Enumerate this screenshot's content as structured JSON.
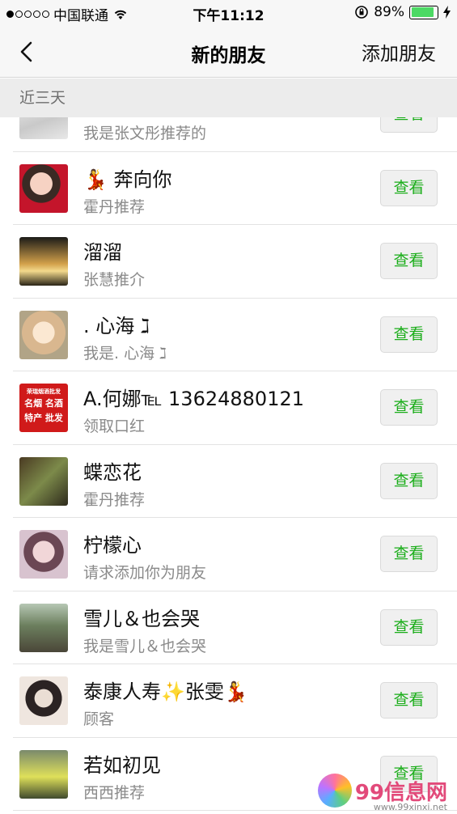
{
  "status_bar": {
    "carrier": "中国联通",
    "time": "下午11:12",
    "battery": "89%",
    "battery_level": 0.89
  },
  "nav": {
    "title": "新的朋友",
    "action": "添加朋友"
  },
  "section": {
    "label": "近三天"
  },
  "friends": [
    {
      "name": "",
      "sub": "我是张文彤推荐的",
      "button": "查看",
      "avatar": "wave"
    },
    {
      "name": "💃 奔向你",
      "sub": "霍丹推荐",
      "button": "查看",
      "avatar": "girl1"
    },
    {
      "name": "溜溜",
      "sub": "张慧推介",
      "button": "查看",
      "avatar": "sunset"
    },
    {
      "name": ". 心海 ℷ",
      "sub": "我是. 心海 ℷ",
      "button": "查看",
      "avatar": "flower"
    },
    {
      "name": "A.何娜℡ 13624880121",
      "sub": "领取口红",
      "button": "查看",
      "avatar": "ad"
    },
    {
      "name": "蝶恋花",
      "sub": "霍丹推荐",
      "button": "查看",
      "avatar": "forest"
    },
    {
      "name": "柠檬心",
      "sub": "请求添加你为朋友",
      "button": "查看",
      "avatar": "girl2"
    },
    {
      "name": "雪儿＆也会哭",
      "sub": "我是雪儿＆也会哭",
      "button": "查看",
      "avatar": "rail"
    },
    {
      "name": "泰康人寿✨张雯💃",
      "sub": "顾客",
      "button": "查看",
      "avatar": "sunglass"
    },
    {
      "name": "若如初见",
      "sub": "西西推荐",
      "button": "查看",
      "avatar": "yellow"
    }
  ],
  "ad_avatar": {
    "line1": "荣瑞烟酒批发",
    "line2": "名烟 名酒",
    "line3": "特产 批发"
  },
  "watermark": {
    "brand": "99信息网",
    "url": "www.99xinxi.net"
  },
  "colors": {
    "accent_green": "#1aad19",
    "battery_green": "#4cd964"
  }
}
